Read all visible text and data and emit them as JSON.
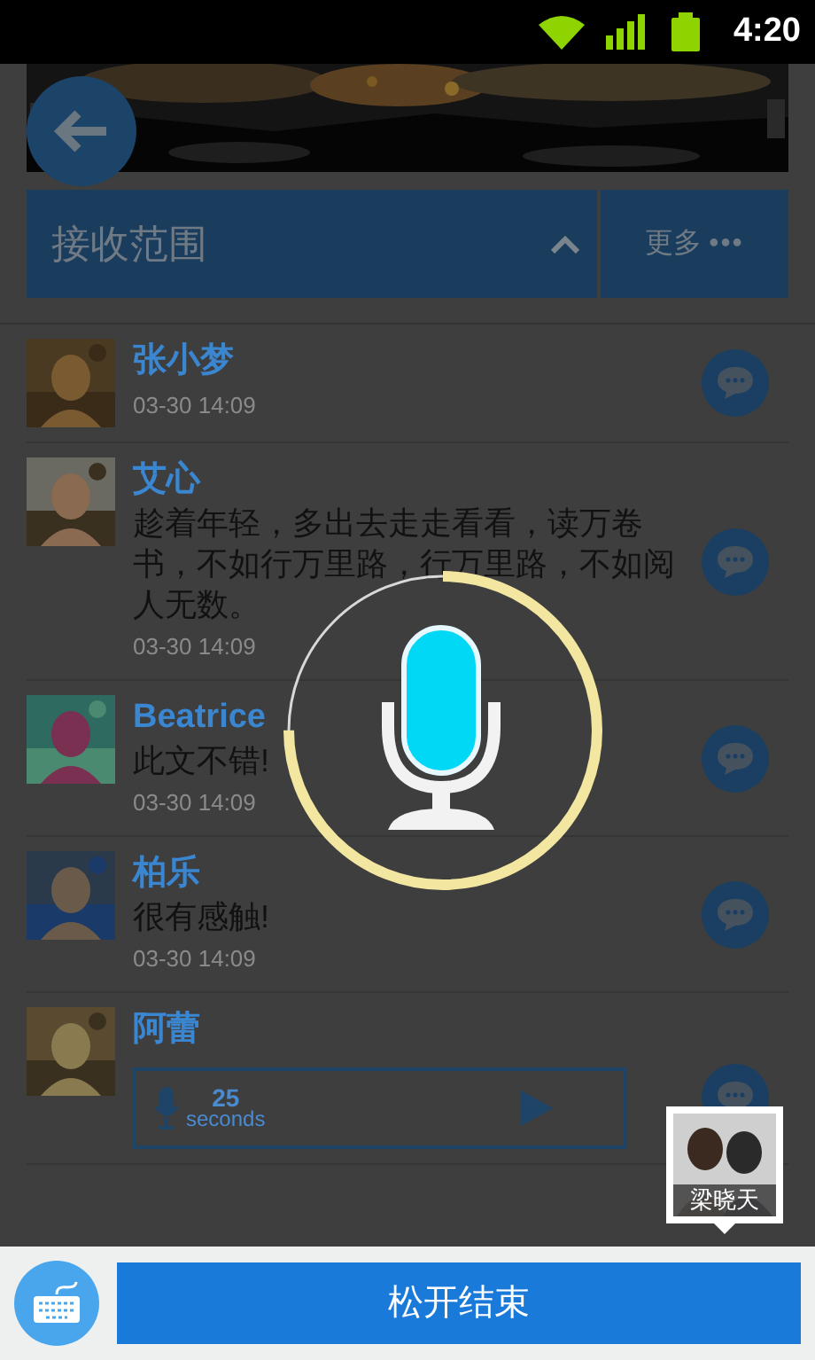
{
  "status_bar": {
    "time": "4:20"
  },
  "header": {
    "scope_tab": "接收范围",
    "expanded": true,
    "more": "更多",
    "more_icon": "•••"
  },
  "rows": [
    {
      "kind": "text",
      "name": "张小梦",
      "time": "03-30 14:09"
    },
    {
      "kind": "text",
      "name": "艾心",
      "text": "趁着年轻，多出去走走看看，读万卷书，不如行万里路，行万里路，不如阅人无数。",
      "time": "03-30 14:09"
    },
    {
      "kind": "text",
      "name": "Beatrice",
      "text": "此文不错!",
      "time": "03-30 14:09"
    },
    {
      "kind": "text",
      "name": "柏乐",
      "text": "很有感触!",
      "time": "03-30 14:09"
    },
    {
      "kind": "voice",
      "name": "阿蕾",
      "duration": "25",
      "unit": "seconds"
    }
  ],
  "floating_contact": {
    "name": "梁晓天"
  },
  "recording": {
    "level": 0.75
  },
  "bottom_bar": {
    "button": "松开结束"
  }
}
